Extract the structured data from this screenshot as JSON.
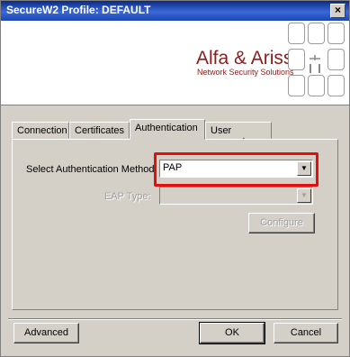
{
  "window": {
    "title": "SecureW2 Profile: DEFAULT"
  },
  "banner": {
    "brand": "Alfa & Ariss",
    "tagline": "Network Security Solutions",
    "brand_color": "#8b1d1d"
  },
  "tabs": [
    {
      "label": "Connection"
    },
    {
      "label": "Certificates"
    },
    {
      "label": "Authentication"
    },
    {
      "label": "User account"
    }
  ],
  "authentication": {
    "method_label": "Select Authentication Method",
    "method_value": "PAP",
    "eap_label": "EAP Type:",
    "eap_value": "",
    "configure_label": "Configure"
  },
  "buttons": {
    "advanced": "Advanced",
    "ok": "OK",
    "cancel": "Cancel"
  },
  "colors": {
    "highlight": "#e30e0e",
    "titlebar": "#0a2a82"
  }
}
